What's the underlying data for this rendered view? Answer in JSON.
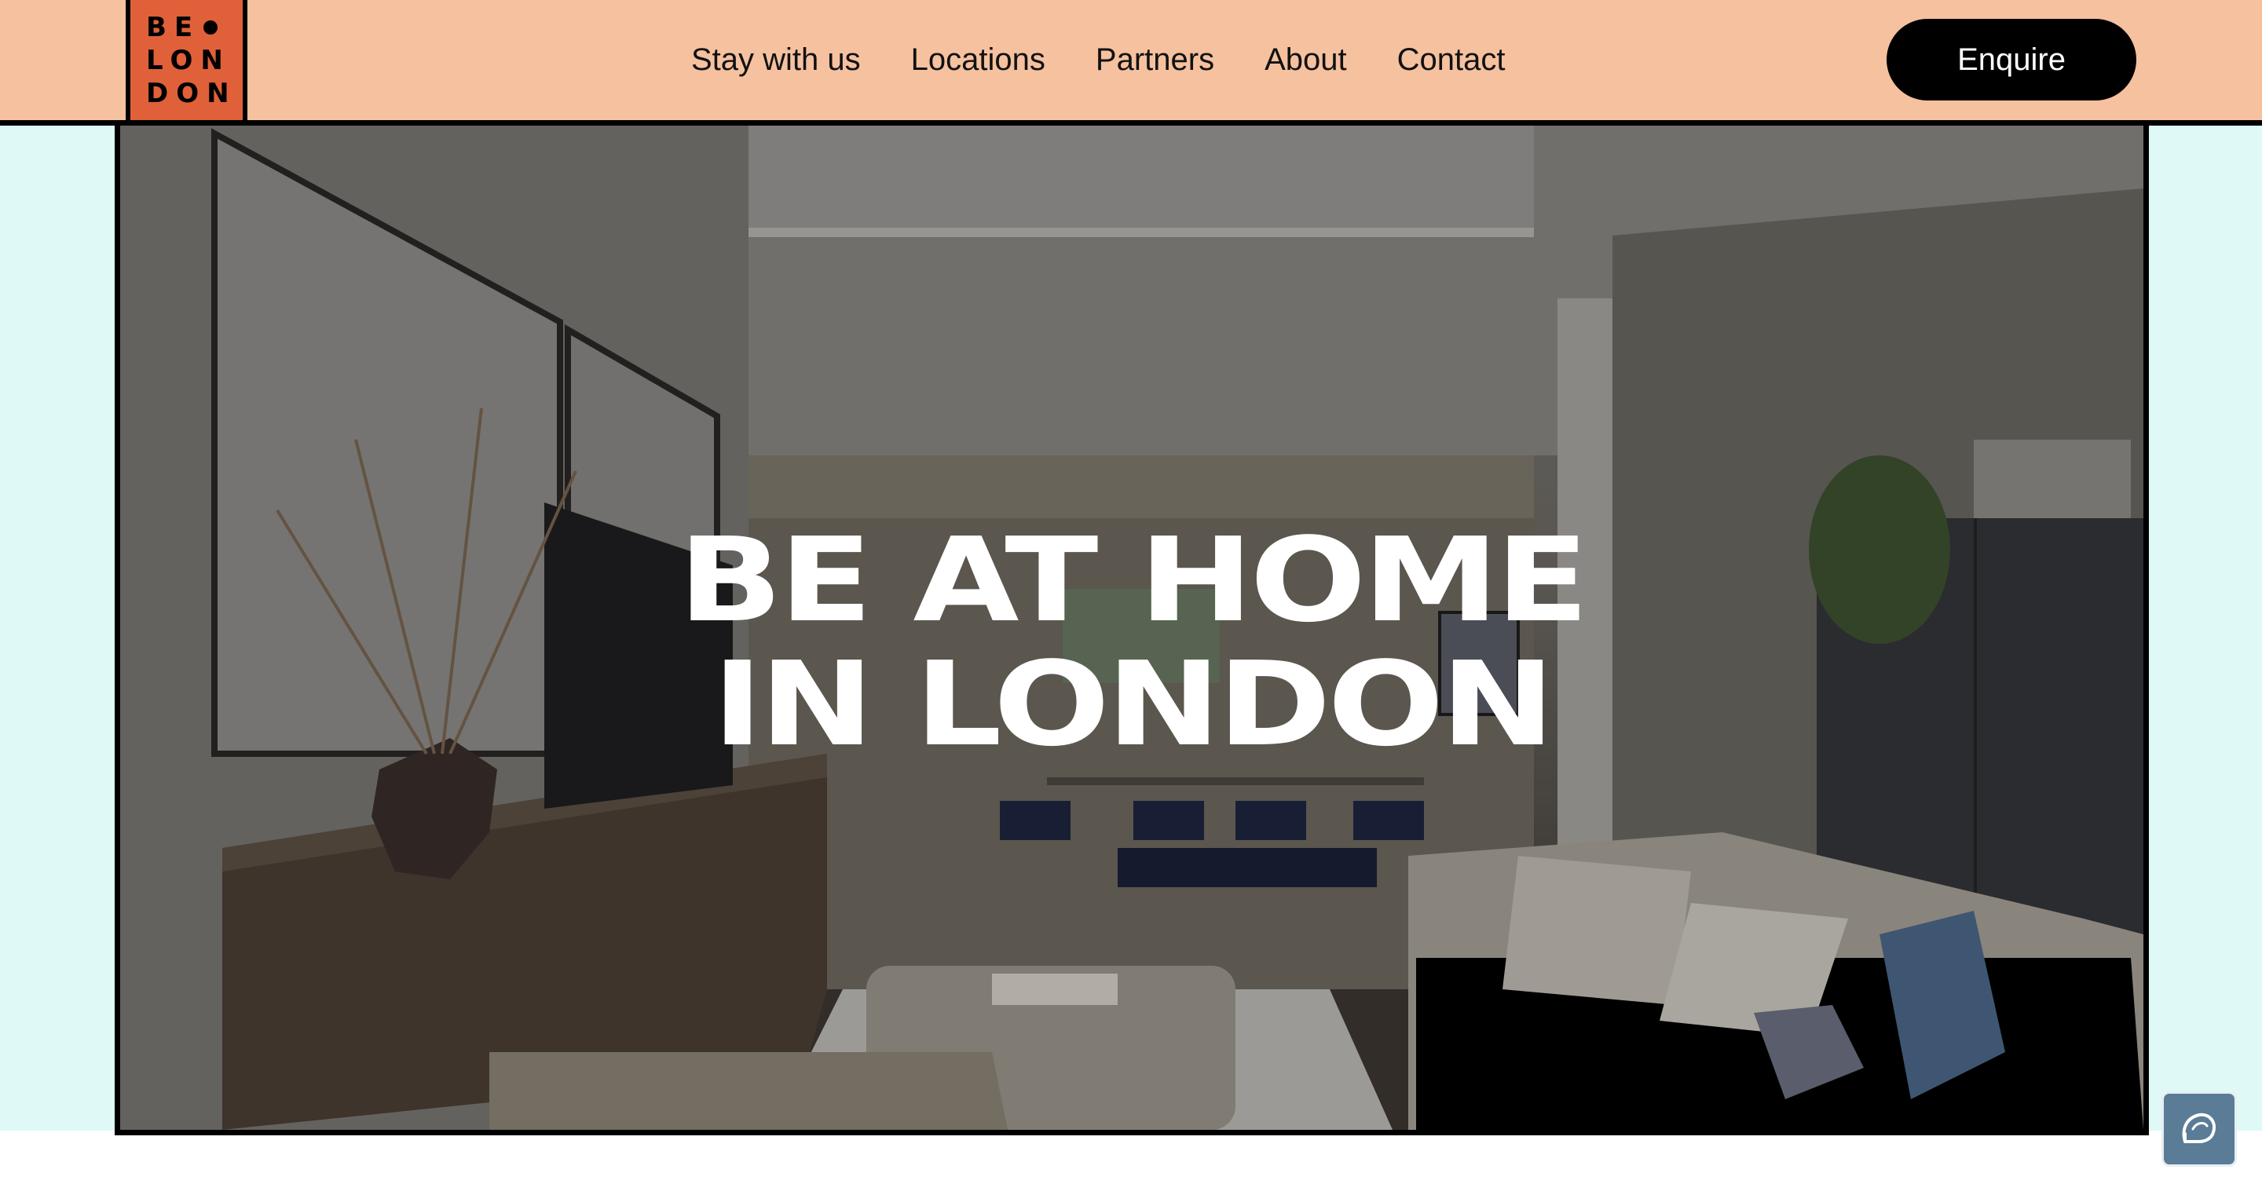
{
  "logo": {
    "line1": "BE",
    "line2": "LON",
    "line3": "DON"
  },
  "nav": {
    "items": [
      {
        "label": "Stay with us"
      },
      {
        "label": "Locations"
      },
      {
        "label": "Partners"
      },
      {
        "label": "About"
      },
      {
        "label": "Contact"
      }
    ]
  },
  "header": {
    "enquire_label": "Enquire"
  },
  "hero": {
    "title_line1": "BE AT HOME",
    "title_line2": "IN LONDON"
  },
  "colors": {
    "header_bg": "#f5c19f",
    "logo_bg": "#e0603a",
    "side_bg": "#dff9f6",
    "button_bg": "#000000",
    "chat_bg": "#5a7c96"
  },
  "icons": {
    "chat": "chat-bubble-icon",
    "logo_dot": "dot-icon"
  }
}
